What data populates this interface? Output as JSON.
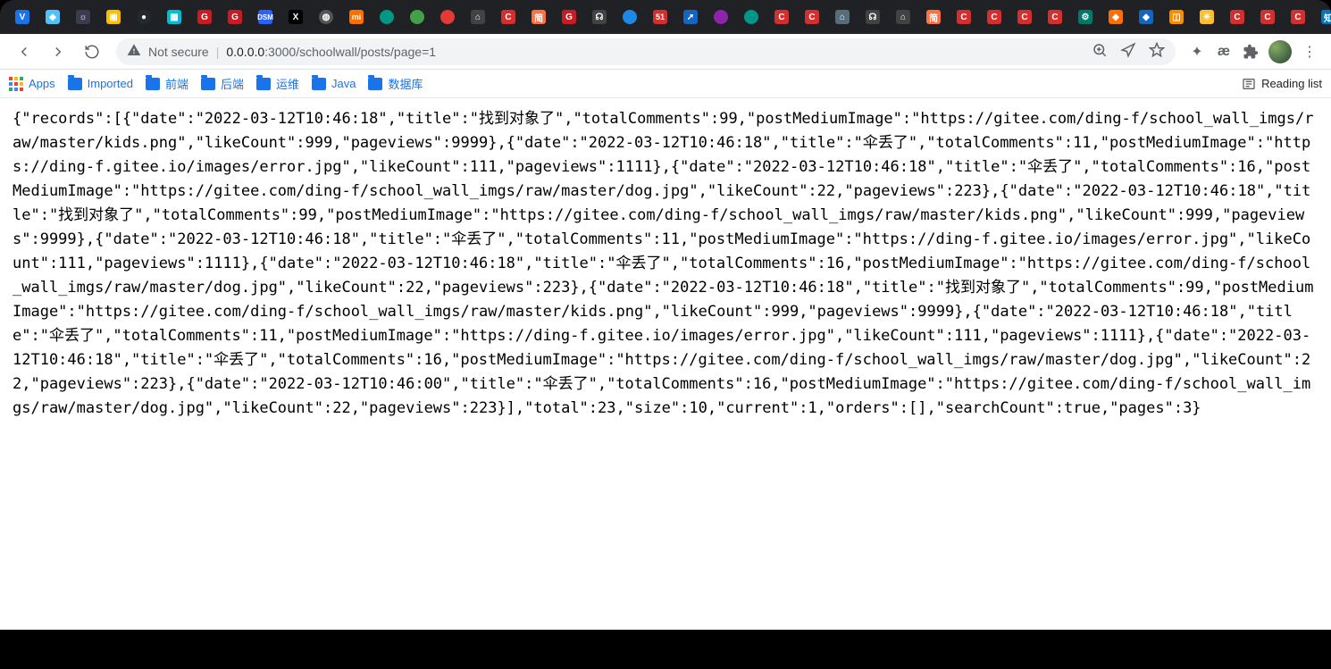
{
  "window": {
    "minimize": "—",
    "maximize": "▢",
    "close": "✕"
  },
  "browser": {
    "active_tab_close": "✕",
    "new_tab": "+",
    "not_secure_label": "Not secure",
    "url_host": "0.0.0.0",
    "url_port": ":3000",
    "url_path": "/schoolwall/posts/page=1",
    "menu_dots": "⋮"
  },
  "bookmarks": {
    "apps": "Apps",
    "items": [
      {
        "label": "Imported"
      },
      {
        "label": "前端"
      },
      {
        "label": "后端"
      },
      {
        "label": "运维"
      },
      {
        "label": "Java"
      },
      {
        "label": "数据库"
      }
    ],
    "reading_list": "Reading list"
  },
  "response": {
    "records": [
      {
        "date": "2022-03-12T10:46:18",
        "title": "找到对象了",
        "totalComments": 99,
        "postMediumImage": "https://gitee.com/ding-f/school_wall_imgs/raw/master/kids.png",
        "likeCount": 999,
        "pageviews": 9999
      },
      {
        "date": "2022-03-12T10:46:18",
        "title": "伞丢了",
        "totalComments": 11,
        "postMediumImage": "https://ding-f.gitee.io/images/error.jpg",
        "likeCount": 111,
        "pageviews": 1111
      },
      {
        "date": "2022-03-12T10:46:18",
        "title": "伞丢了",
        "totalComments": 16,
        "postMediumImage": "https://gitee.com/ding-f/school_wall_imgs/raw/master/dog.jpg",
        "likeCount": 22,
        "pageviews": 223
      },
      {
        "date": "2022-03-12T10:46:18",
        "title": "找到对象了",
        "totalComments": 99,
        "postMediumImage": "https://gitee.com/ding-f/school_wall_imgs/raw/master/kids.png",
        "likeCount": 999,
        "pageviews": 9999
      },
      {
        "date": "2022-03-12T10:46:18",
        "title": "伞丢了",
        "totalComments": 11,
        "postMediumImage": "https://ding-f.gitee.io/images/error.jpg",
        "likeCount": 111,
        "pageviews": 1111
      },
      {
        "date": "2022-03-12T10:46:18",
        "title": "伞丢了",
        "totalComments": 16,
        "postMediumImage": "https://gitee.com/ding-f/school_wall_imgs/raw/master/dog.jpg",
        "likeCount": 22,
        "pageviews": 223
      },
      {
        "date": "2022-03-12T10:46:18",
        "title": "找到对象了",
        "totalComments": 99,
        "postMediumImage": "https://gitee.com/ding-f/school_wall_imgs/raw/master/kids.png",
        "likeCount": 999,
        "pageviews": 9999
      },
      {
        "date": "2022-03-12T10:46:18",
        "title": "伞丢了",
        "totalComments": 11,
        "postMediumImage": "https://ding-f.gitee.io/images/error.jpg",
        "likeCount": 111,
        "pageviews": 1111
      },
      {
        "date": "2022-03-12T10:46:18",
        "title": "伞丢了",
        "totalComments": 16,
        "postMediumImage": "https://gitee.com/ding-f/school_wall_imgs/raw/master/dog.jpg",
        "likeCount": 22,
        "pageviews": 223
      },
      {
        "date": "2022-03-12T10:46:00",
        "title": "伞丢了",
        "totalComments": 16,
        "postMediumImage": "https://gitee.com/ding-f/school_wall_imgs/raw/master/dog.jpg",
        "likeCount": 22,
        "pageviews": 223
      }
    ],
    "total": 23,
    "size": 10,
    "current": 1,
    "orders": [],
    "searchCount": true,
    "pages": 3
  }
}
